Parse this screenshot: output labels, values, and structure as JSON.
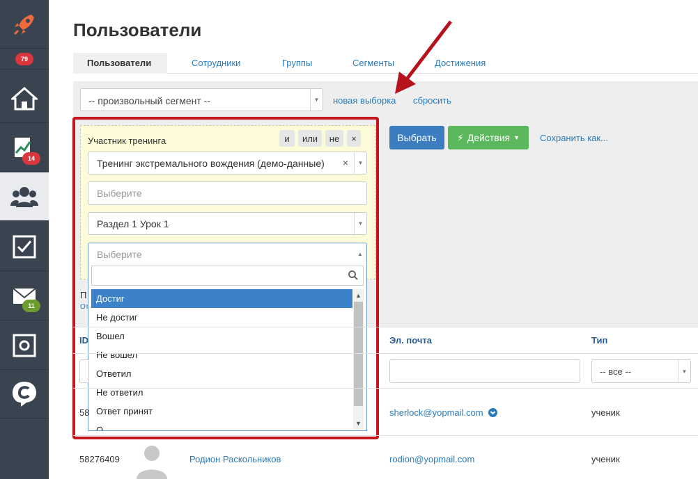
{
  "sidebar": {
    "items": [
      {
        "icon": "rocket-icon",
        "badge": ""
      },
      {
        "icon": "badge-only",
        "badge": "79"
      },
      {
        "icon": "home-icon",
        "badge": ""
      },
      {
        "icon": "chart-icon",
        "badge": "14"
      },
      {
        "icon": "users-icon",
        "badge": ""
      },
      {
        "icon": "checkbox-icon",
        "badge": ""
      },
      {
        "icon": "mail-icon",
        "badge": "11"
      },
      {
        "icon": "safe-icon",
        "badge": ""
      },
      {
        "icon": "chat-c-icon",
        "badge": ""
      }
    ]
  },
  "page": {
    "title": "Пользователи"
  },
  "tabs": [
    "Пользователи",
    "Сотрудники",
    "Группы",
    "Сегменты",
    "Достижения"
  ],
  "segment": {
    "value": "-- произвольный сегмент --",
    "new_link": "новая выборка",
    "reset_link": "сбросить"
  },
  "filter": {
    "label": "Участник тренинга",
    "ops": [
      "и",
      "или",
      "не",
      "×"
    ],
    "training": "Тренинг экстремального вождения (демо-данные)",
    "clear": "×",
    "placeholder1": "Выберите",
    "lesson": "Раздел 1 Урок 1",
    "placeholder2": "Выберите",
    "options": [
      "Достиг",
      "Не достиг",
      "Вошел",
      "Не вошел",
      "Ответил",
      "Не ответил",
      "Ответ принят",
      "О"
    ]
  },
  "peek": {
    "p": "П",
    "ot": "От"
  },
  "actions": {
    "select": "Выбрать",
    "actions": "Действия",
    "save_as": "Сохранить как..."
  },
  "table": {
    "headers": {
      "id": "ID",
      "email": "Эл. почта",
      "type": "Тип"
    },
    "type_filter": "-- все --",
    "rows": [
      {
        "id": "58",
        "name": "",
        "email": "sherlock@yopmail.com",
        "type": "ученик"
      },
      {
        "id": "58276409",
        "name": "Родион Раскольников",
        "email": "rodion@yopmail.com",
        "type": "ученик"
      }
    ]
  },
  "colors": {
    "accent": "#3c7dc0",
    "green": "#5cb85c",
    "highlight": "#c4161c",
    "sidebar": "#3a4450"
  }
}
